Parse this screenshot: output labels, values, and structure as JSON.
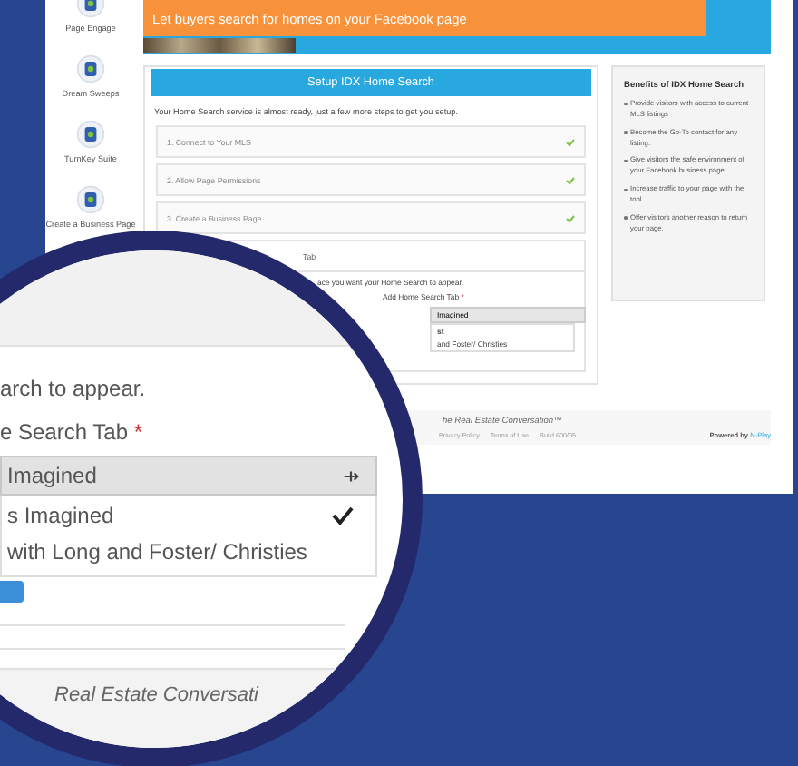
{
  "sidebar": {
    "items": [
      {
        "label": "Page Engage"
      },
      {
        "label": "Dream Sweeps"
      },
      {
        "label": "TurnKey Suite"
      },
      {
        "label": "Create a Business Page"
      }
    ]
  },
  "banner": {
    "headline": "Let buyers search for homes on your Facebook page"
  },
  "setup": {
    "title": "Setup IDX Home Search",
    "intro": "Your Home Search service is almost ready, just a few more steps to get you setup.",
    "steps": [
      {
        "label": "1. Connect to Your MLS",
        "done": true
      },
      {
        "label": "2. Allow Page Permissions",
        "done": true
      },
      {
        "label": "3. Create a Business Page",
        "done": true
      }
    ],
    "open_step": {
      "label": "Tab",
      "hint": "ace you want your Home Search to appear.",
      "field_label": "Add Home Search Tab",
      "required": "*",
      "dropdown_value": "Imagined",
      "options": [
        {
          "label": "st",
          "selected": true
        },
        {
          "label": "and Foster/ Christies",
          "selected": false
        }
      ]
    }
  },
  "benefits": {
    "title": "Benefits of IDX Home Search",
    "items": [
      "Provide visitors with access to current MLS listings",
      "Become the Go-To contact for any listing.",
      "Give visitors the safe environment of your Facebook business page.",
      "Increase traffic to your page with the tool.",
      "Offer visitors another reason to return your page."
    ]
  },
  "footer": {
    "tagline": "he Real Estate Conversation™",
    "links": [
      "Privacy Policy",
      "Terms of Use",
      "Build 600/05"
    ],
    "powered_label": "Powered by",
    "powered_brand": "N-Play"
  },
  "magnifier": {
    "hint": "arch to appear.",
    "field_label": "e Search Tab",
    "required": "*",
    "dropdown_value": "Imagined",
    "options": [
      {
        "label": "s Imagined",
        "selected": true
      },
      {
        "label": "with Long and Foster/ Christies",
        "selected": false
      }
    ],
    "tagline": "Real Estate Conversati"
  }
}
